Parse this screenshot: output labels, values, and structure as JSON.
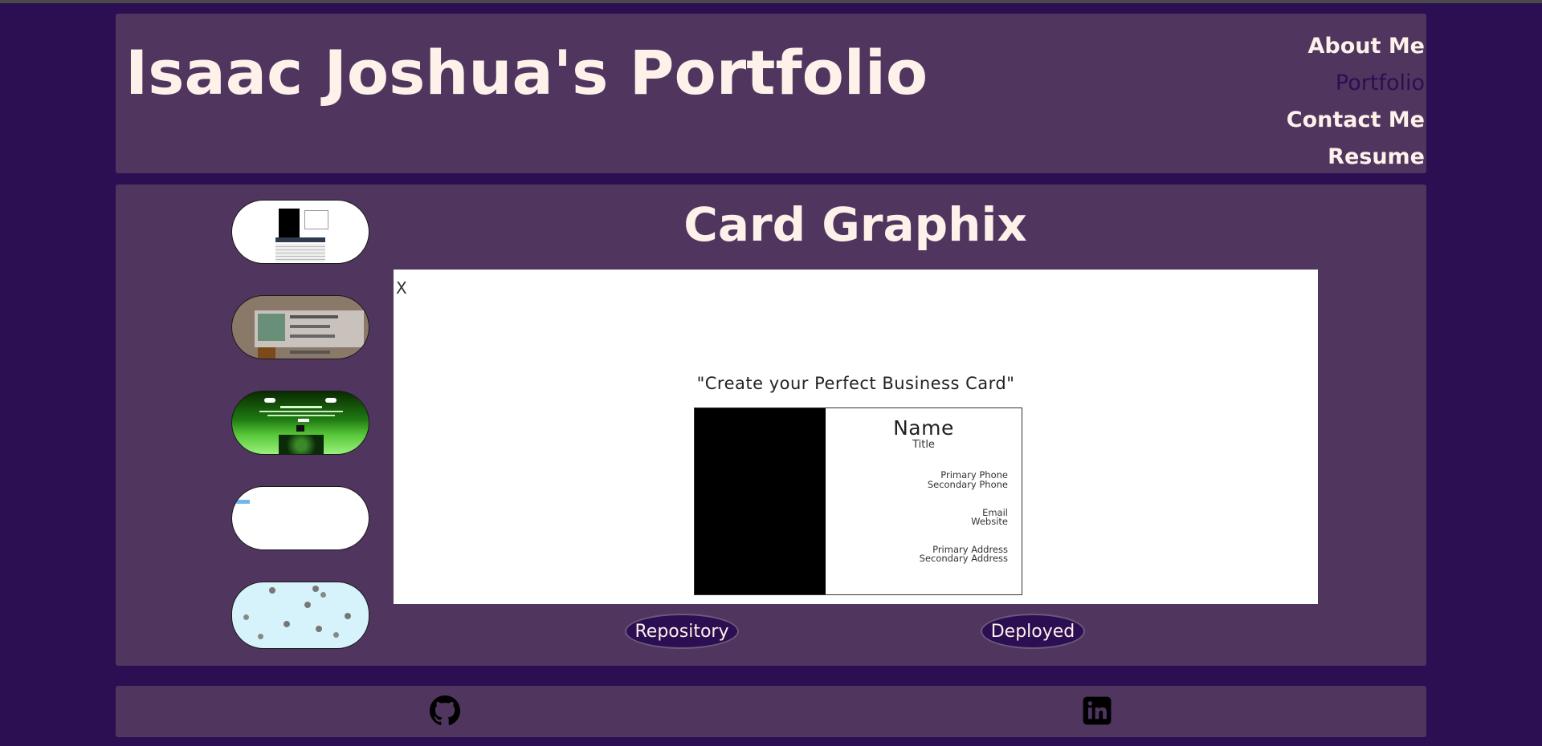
{
  "header": {
    "title": "Isaac Joshua's Portfolio",
    "nav": [
      {
        "label": "About Me",
        "active": false
      },
      {
        "label": "Portfolio",
        "active": true
      },
      {
        "label": "Contact Me",
        "active": false
      },
      {
        "label": "Resume",
        "active": false
      }
    ]
  },
  "main": {
    "project_title": "Card Graphix",
    "preview": {
      "close_label": "X",
      "tagline": "\"Create your Perfect Business Card\"",
      "card": {
        "name": "Name",
        "title": "Title",
        "primary_phone": "Primary Phone",
        "secondary_phone": "Secondary Phone",
        "email": "Email",
        "website": "Website",
        "primary_address": "Primary Address",
        "secondary_address": "Secondary Address"
      }
    },
    "buttons": {
      "repository": "Repository",
      "deployed": "Deployed"
    },
    "thumbnails": [
      {
        "name": "thumbnail-1"
      },
      {
        "name": "thumbnail-2"
      },
      {
        "name": "thumbnail-3"
      },
      {
        "name": "thumbnail-4"
      },
      {
        "name": "thumbnail-5"
      }
    ]
  },
  "footer": {
    "icons": [
      "github-icon",
      "linkedin-icon"
    ]
  },
  "colors": {
    "background": "#2c0e52",
    "panel": "#50355f",
    "text": "#fdf1ea",
    "nav_active": "#2c0e52"
  }
}
